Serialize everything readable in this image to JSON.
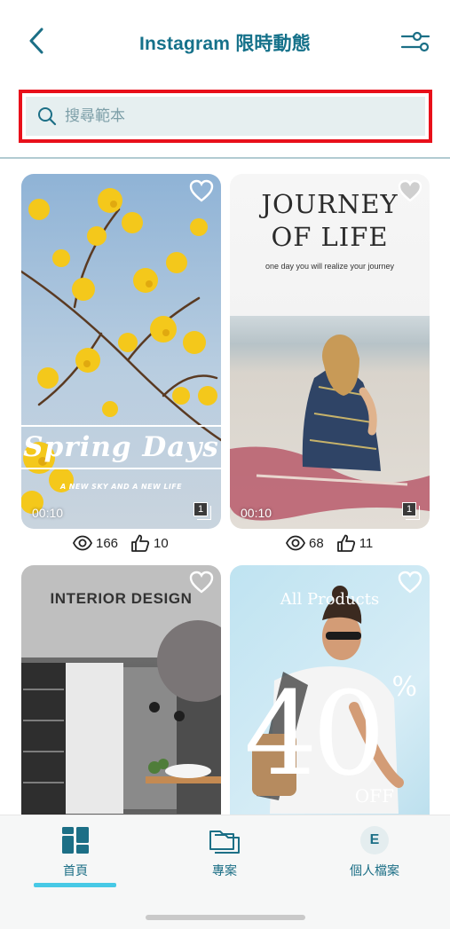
{
  "header": {
    "title": "Instagram 限時動態",
    "back_icon": "chevron-left-icon",
    "filter_icon": "sliders-icon"
  },
  "search": {
    "placeholder": "搜尋範本",
    "value": "",
    "icon": "search-icon"
  },
  "templates": [
    {
      "name": "spring-days",
      "title": "Spring Days",
      "subtitle": "A NEW SKY AND A NEW LIFE",
      "duration": "00:10",
      "pages": "1",
      "views": "166",
      "likes": "10"
    },
    {
      "name": "journey-of-life",
      "title_line1": "JOURNEY",
      "title_line2": "OF LIFE",
      "subtitle": "one day you will realize your journey",
      "duration": "00:10",
      "pages": "1",
      "views": "68",
      "likes": "11"
    },
    {
      "name": "interior-design",
      "title": "INTERIOR DESIGN"
    },
    {
      "name": "all-products",
      "title": "All Products",
      "big": "40",
      "percent": "%",
      "off": "OFF"
    }
  ],
  "nav": {
    "home": "首頁",
    "projects": "專案",
    "profile": "個人檔案",
    "avatar_initial": "E",
    "active": "home"
  },
  "colors": {
    "accent": "#15718a",
    "highlight_border": "#e8101a",
    "nav_underline": "#47c9e6"
  }
}
